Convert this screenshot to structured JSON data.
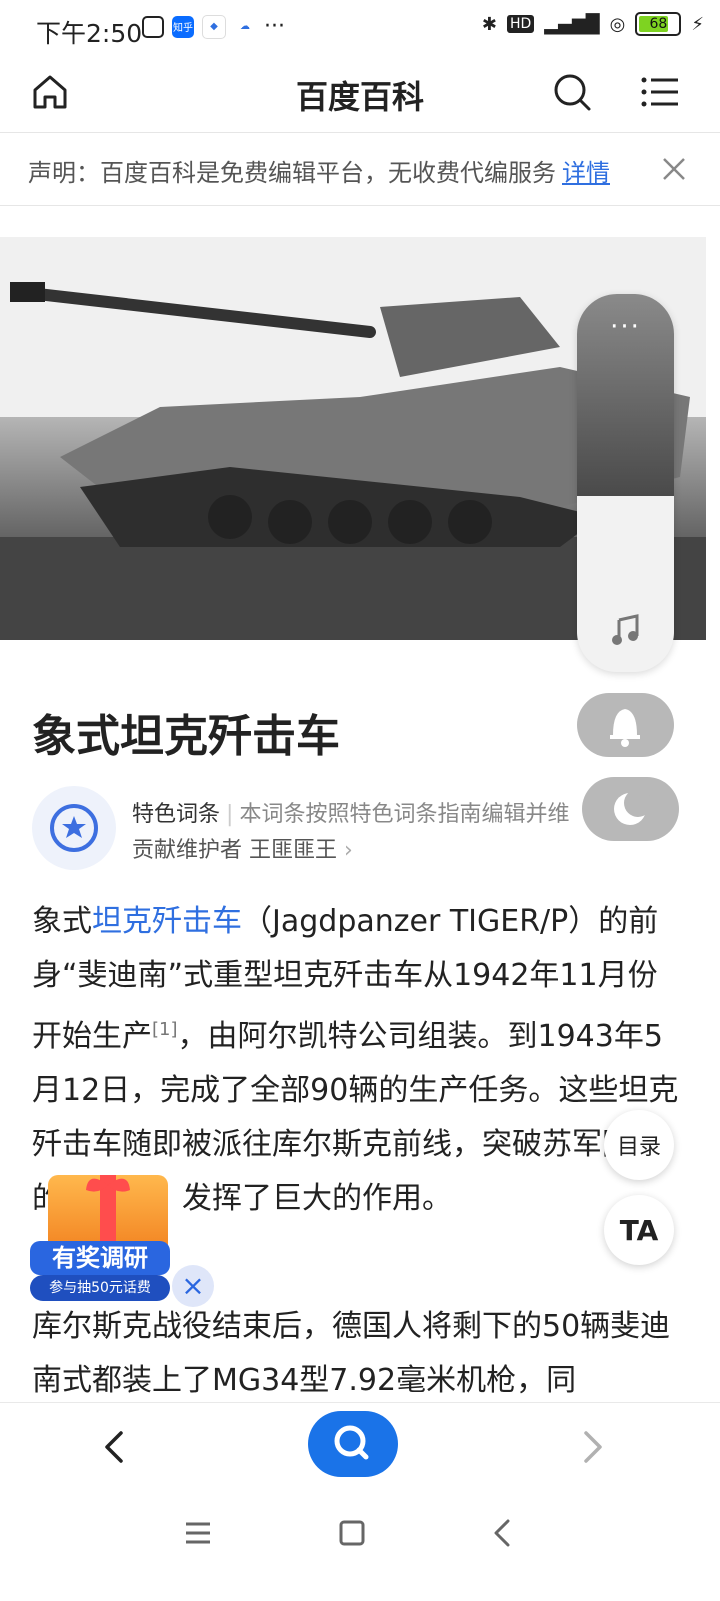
{
  "status": {
    "time": "下午2:50",
    "apps": [
      "知乎"
    ],
    "battery": "68"
  },
  "header": {
    "title": "百度百科"
  },
  "notice": {
    "text": "声明：百度百科是免费编辑平台，无收费代编服务",
    "link": "详情"
  },
  "page": {
    "title": "象式坦克歼击车",
    "feature_tag": "特色词条",
    "feature_desc": "本词条按照特色词条指南编辑并维",
    "contributor": "贡献维护者 王匪匪王"
  },
  "content": {
    "p1_prefix": "象式",
    "p1_link": "坦克歼击车",
    "p1_mid": "（Jagdpanzer TIGER/P）的前身“斐迪南”式重型坦克歼击车从1942年11月份开始生产",
    "p1_ref": "[1]",
    "p1_rest": "，由阿尔凯特公司组装。到1943年5月12日，完成了全部90辆的生产任务。这些坦克歼击车随即被派往库尔斯克前线，突破苏军防御的战斗中，发挥了巨大的作用。",
    "p2": "库尔斯克战役结束后，德国人将剩下的50辆斐迪南式都装上了MG34型7.92毫米机枪，同"
  },
  "float": {
    "dots": "···",
    "toc_label": "目录",
    "ta_label": "TA"
  },
  "promo": {
    "title": "有奖调研",
    "subtitle": "参与抽50元话费",
    "close": "×"
  },
  "colors": {
    "link": "#2f6fe0",
    "search_button": "#1a73e8"
  }
}
